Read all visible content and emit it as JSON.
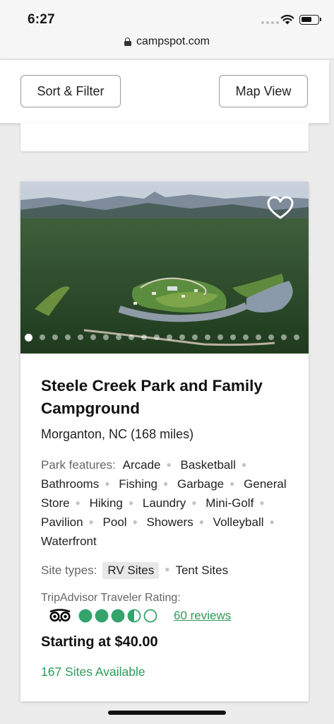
{
  "status_bar": {
    "time": "6:27"
  },
  "browser": {
    "url": "campspot.com"
  },
  "toolbar": {
    "sort_label": "Sort & Filter",
    "map_label": "Map View"
  },
  "listing": {
    "title": "Steele Creek Park and Family Campground",
    "location": "Morganton, NC (168 miles)",
    "photo_count": 22,
    "active_photo_index": 0,
    "favorited": false,
    "features_label": "Park features:",
    "features": [
      "Arcade",
      "Basketball",
      "Bathrooms",
      "Fishing",
      "Garbage",
      "General Store",
      "Hiking",
      "Laundry",
      "Mini-Golf",
      "Pavilion",
      "Pool",
      "Showers",
      "Volleyball",
      "Waterfront"
    ],
    "site_types_label": "Site types:",
    "site_types": [
      "RV Sites",
      "Tent Sites"
    ],
    "tripadvisor": {
      "label": "TripAdvisor Traveler Rating:",
      "rating": 3.5,
      "max": 5,
      "reviews_label": "60 reviews"
    },
    "price": "Starting at $40.00",
    "availability": "167 Sites Available"
  },
  "colors": {
    "accent_green": "#2e9b5a",
    "rating_green": "#34a46c"
  }
}
